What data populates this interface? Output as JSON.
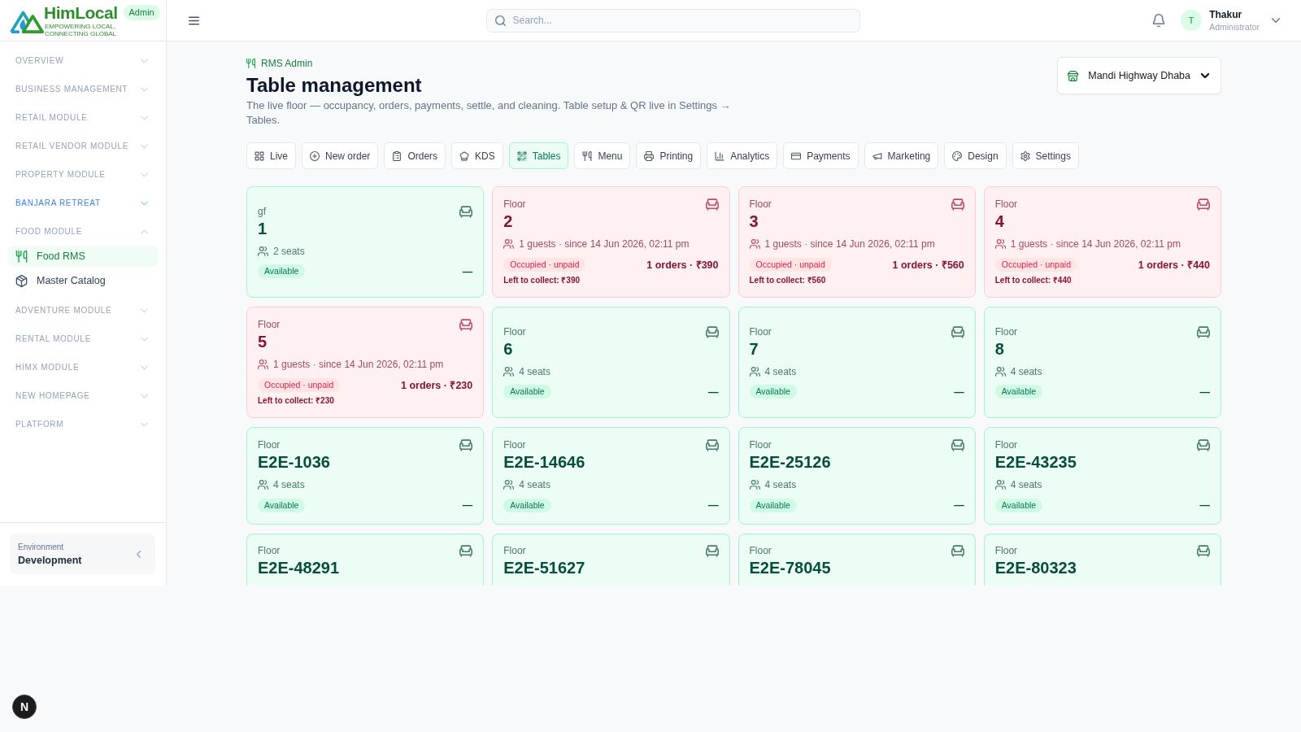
{
  "brand": {
    "name": "HimLocal",
    "tagline": "EMPOWERING LOCAL, CONNECTING GLOBAL",
    "badge": "Admin"
  },
  "search": {
    "placeholder": "Search..."
  },
  "user": {
    "initial": "T",
    "name": "Thakur",
    "role": "Administrator"
  },
  "sidebar": {
    "sections": [
      {
        "label": "OVERVIEW",
        "expanded": false,
        "highlighted": false
      },
      {
        "label": "BUSINESS MANAGEMENT",
        "expanded": false,
        "highlighted": false
      },
      {
        "label": "RETAIL MODULE",
        "expanded": false,
        "highlighted": false
      },
      {
        "label": "RETAIL VENDOR MODULE",
        "expanded": false,
        "highlighted": false
      },
      {
        "label": "PROPERTY MODULE",
        "expanded": false,
        "highlighted": false
      },
      {
        "label": "BANJARA RETREAT",
        "expanded": false,
        "highlighted": true
      },
      {
        "label": "FOOD MODULE",
        "expanded": true,
        "highlighted": false,
        "children": [
          {
            "label": "Food RMS",
            "selected": true
          },
          {
            "label": "Master Catalog",
            "selected": false
          }
        ]
      },
      {
        "label": "ADVENTURE MODULE",
        "expanded": false,
        "highlighted": false
      },
      {
        "label": "RENTAL MODULE",
        "expanded": false,
        "highlighted": false
      },
      {
        "label": "HIMX MODULE",
        "expanded": false,
        "highlighted": false
      },
      {
        "label": "NEW HOMEPAGE",
        "expanded": false,
        "highlighted": false
      },
      {
        "label": "PLATFORM",
        "expanded": false,
        "highlighted": false
      }
    ],
    "environment": {
      "label": "Environment",
      "value": "Development"
    }
  },
  "page": {
    "breadcrumb": "RMS Admin",
    "title": "Table management",
    "description": "The live floor — occupancy, orders, payments, settle, and cleaning. Table setup & QR live in Settings → Tables.",
    "venue": "Mandi Highway Dhaba"
  },
  "tabs": [
    {
      "label": "Live",
      "selected": false
    },
    {
      "label": "New order",
      "selected": false
    },
    {
      "label": "Orders",
      "selected": false
    },
    {
      "label": "KDS",
      "selected": false
    },
    {
      "label": "Tables",
      "selected": true
    },
    {
      "label": "Menu",
      "selected": false
    },
    {
      "label": "Printing",
      "selected": false
    },
    {
      "label": "Analytics",
      "selected": false
    },
    {
      "label": "Payments",
      "selected": false
    },
    {
      "label": "Marketing",
      "selected": false
    },
    {
      "label": "Design",
      "selected": false
    },
    {
      "label": "Settings",
      "selected": false
    }
  ],
  "tables": [
    {
      "area": "gf",
      "name": "1",
      "occupied": false,
      "info": "2 seats",
      "badge": "Available",
      "summary": "—"
    },
    {
      "area": "Floor",
      "name": "2",
      "occupied": true,
      "info": "1 guests · since 14 Jun 2026, 02:11 pm",
      "badge": "Occupied · unpaid",
      "summary": "1 orders · ₹390",
      "due": "Left to collect: ₹390"
    },
    {
      "area": "Floor",
      "name": "3",
      "occupied": true,
      "info": "1 guests · since 14 Jun 2026, 02:11 pm",
      "badge": "Occupied · unpaid",
      "summary": "1 orders · ₹560",
      "due": "Left to collect: ₹560"
    },
    {
      "area": "Floor",
      "name": "4",
      "occupied": true,
      "info": "1 guests · since 14 Jun 2026, 02:11 pm",
      "badge": "Occupied · unpaid",
      "summary": "1 orders · ₹440",
      "due": "Left to collect: ₹440"
    },
    {
      "area": "Floor",
      "name": "5",
      "occupied": true,
      "info": "1 guests · since 14 Jun 2026, 02:11 pm",
      "badge": "Occupied · unpaid",
      "summary": "1 orders · ₹230",
      "due": "Left to collect: ₹230"
    },
    {
      "area": "Floor",
      "name": "6",
      "occupied": false,
      "info": "4 seats",
      "badge": "Available",
      "summary": "—"
    },
    {
      "area": "Floor",
      "name": "7",
      "occupied": false,
      "info": "4 seats",
      "badge": "Available",
      "summary": "—"
    },
    {
      "area": "Floor",
      "name": "8",
      "occupied": false,
      "info": "4 seats",
      "badge": "Available",
      "summary": "—"
    },
    {
      "area": "Floor",
      "name": "E2E-1036",
      "occupied": false,
      "info": "4 seats",
      "badge": "Available",
      "summary": "—"
    },
    {
      "area": "Floor",
      "name": "E2E-14646",
      "occupied": false,
      "info": "4 seats",
      "badge": "Available",
      "summary": "—"
    },
    {
      "area": "Floor",
      "name": "E2E-25126",
      "occupied": false,
      "info": "4 seats",
      "badge": "Available",
      "summary": "—"
    },
    {
      "area": "Floor",
      "name": "E2E-43235",
      "occupied": false,
      "info": "4 seats",
      "badge": "Available",
      "summary": "—"
    },
    {
      "area": "Floor",
      "name": "E2E-48291",
      "occupied": false
    },
    {
      "area": "Floor",
      "name": "E2E-51627",
      "occupied": false
    },
    {
      "area": "Floor",
      "name": "E2E-78045",
      "occupied": false
    },
    {
      "area": "Floor",
      "name": "E2E-80323",
      "occupied": false
    }
  ],
  "dev_badge": "N"
}
